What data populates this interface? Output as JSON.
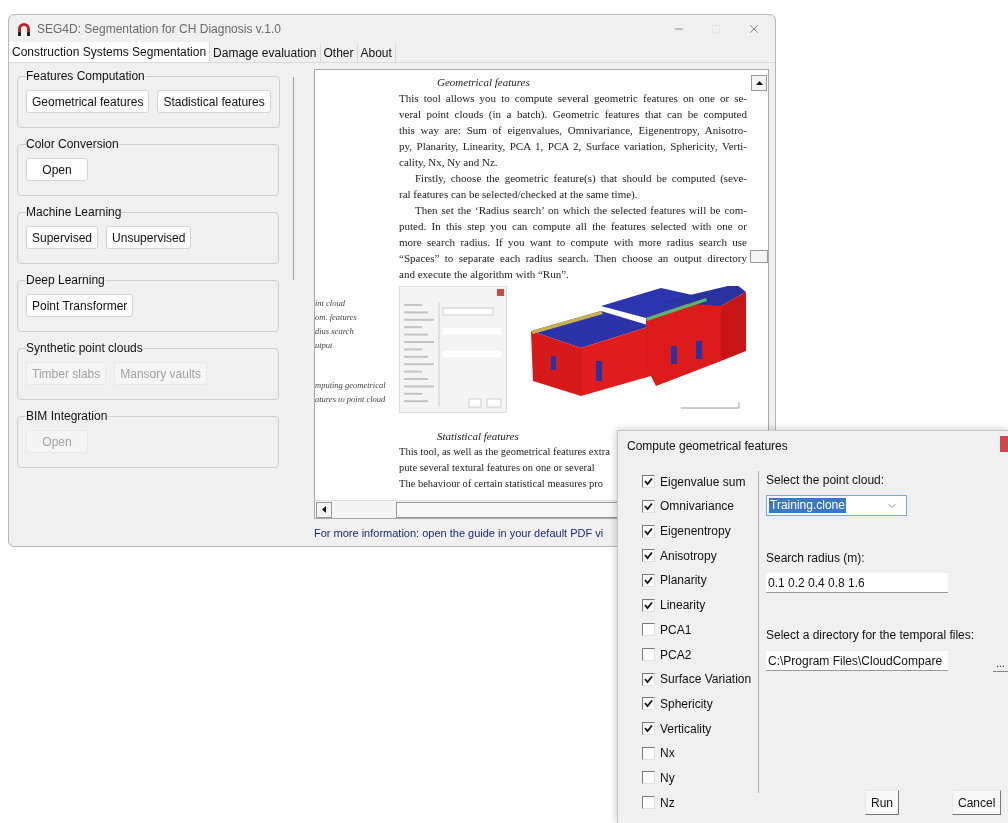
{
  "main_window": {
    "title": "SEG4D: Segmentation for CH Diagnosis v.1.0",
    "tabs": [
      {
        "label": "Construction Systems Segmentation",
        "selected": true
      },
      {
        "label": "Damage evaluation",
        "selected": false
      },
      {
        "label": "Other",
        "selected": false
      },
      {
        "label": "About",
        "selected": false
      }
    ],
    "groups": [
      {
        "title": "Features Computation",
        "buttons": [
          {
            "label": "Geometrical features",
            "disabled": false
          },
          {
            "label": "Stadistical features",
            "disabled": false
          }
        ]
      },
      {
        "title": "Color Conversion",
        "buttons": [
          {
            "label": "Open",
            "disabled": false
          }
        ]
      },
      {
        "title": "Machine Learning",
        "buttons": [
          {
            "label": "Supervised",
            "disabled": false
          },
          {
            "label": "Unsupervised",
            "disabled": false
          }
        ]
      },
      {
        "title": "Deep Learning",
        "buttons": [
          {
            "label": "Point Transformer",
            "disabled": false
          }
        ]
      },
      {
        "title": "Synthetic point clouds",
        "buttons": [
          {
            "label": "Timber slabs",
            "disabled": true
          },
          {
            "label": "Mansory vaults",
            "disabled": true
          }
        ]
      },
      {
        "title": "BIM Integration",
        "buttons": [
          {
            "label": "Open",
            "disabled": true
          }
        ]
      }
    ],
    "document": {
      "geometrical": {
        "title": "Geometrical features",
        "paragraphs": [
          {
            "indent": false,
            "lines": [
              "This tool allows you to compute several geometric features on one or se-",
              "veral point clouds (in a batch). Geometric features that can be computed",
              "this way are: Sum of eigenvalues, Omnivariance, Eigenentropy, Anisotro-",
              "py, Planarity, Linearity, PCA 1, PCA 2, Surface variation, Sphericity, Verti-",
              "cality, Nx, Ny and Nz."
            ]
          },
          {
            "indent": true,
            "lines": [
              "Firstly, choose the geometric feature(s) that should be computed (seve-",
              "ral features can be selected/checked at the same time)."
            ]
          },
          {
            "indent": true,
            "lines": [
              "Then set the ‘Radius search’ on which the selected features will be com-",
              "puted. In this step you can compute all the features selected with one or",
              "more search radius. If you want to compute with more radius search use",
              "“Spaces” to separate each radius search. Then choose an output directory",
              "and execute the algorithm with “Run”."
            ]
          }
        ]
      },
      "figure": {
        "captions": [
          {
            "lines": [
              "int cloud",
              "om. features",
              "dius search",
              "utput"
            ]
          },
          {
            "lines": [
              "mputing geometrical",
              "atures to point cloud"
            ]
          }
        ]
      },
      "statistical": {
        "title": "Statistical features",
        "lines": [
          "This tool, as well as the geometrical features extra",
          "pute several textural features on one or several",
          "The behaviour of certain statistical measures pro"
        ]
      }
    },
    "footer": "For more information: open the guide in your default PDF vi"
  },
  "dialog": {
    "title": "Compute geometrical features",
    "features": [
      {
        "label": "Eigenvalue sum",
        "checked": true
      },
      {
        "label": "Omnivariance",
        "checked": true
      },
      {
        "label": "Eigenentropy",
        "checked": true
      },
      {
        "label": "Anisotropy",
        "checked": true
      },
      {
        "label": "Planarity",
        "checked": true
      },
      {
        "label": "Linearity",
        "checked": true
      },
      {
        "label": "PCA1",
        "checked": false
      },
      {
        "label": "PCA2",
        "checked": false
      },
      {
        "label": "Surface Variation",
        "checked": true
      },
      {
        "label": "Sphericity",
        "checked": true
      },
      {
        "label": "Verticality",
        "checked": true
      },
      {
        "label": "Nx",
        "checked": false
      },
      {
        "label": "Ny",
        "checked": false
      },
      {
        "label": "Nz",
        "checked": false
      }
    ],
    "point_cloud": {
      "label": "Select the point cloud:",
      "value": "Training.clone"
    },
    "radius": {
      "label": "Search radius (m):",
      "value": "0.1 0.2 0.4 0.8 1.6"
    },
    "directory": {
      "label": "Select a directory for the temporal files:",
      "value": "C:\\Program Files\\CloudCompare"
    },
    "browse_button": "...",
    "buttons": [
      "Run",
      "Cancel"
    ]
  }
}
